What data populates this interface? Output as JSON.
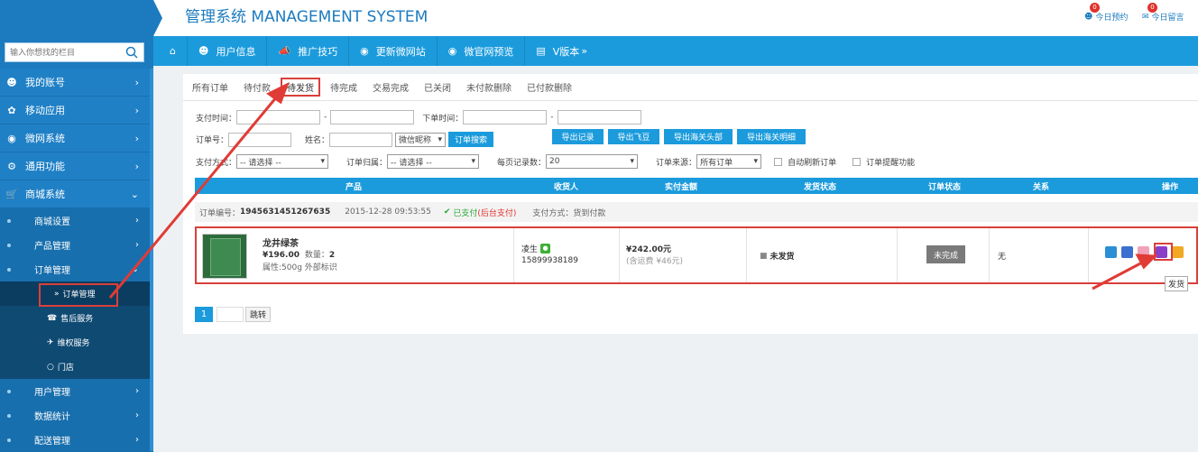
{
  "header": {
    "title": "管理系统 MANAGEMENT SYSTEM",
    "links": [
      {
        "label": "今日预约",
        "badge": "0",
        "icon": "user-icon"
      },
      {
        "label": "今日留言",
        "badge": "0",
        "icon": "message-icon"
      }
    ]
  },
  "sidebar": {
    "search_placeholder": "输入你想找的栏目",
    "items": [
      {
        "label": "我的账号",
        "icon": "user-icon"
      },
      {
        "label": "移动应用",
        "icon": "apps-icon"
      },
      {
        "label": "微网系统",
        "icon": "globe-icon"
      },
      {
        "label": "通用功能",
        "icon": "tool-icon"
      },
      {
        "label": "商城系统",
        "icon": "cart-icon"
      }
    ],
    "subitems": [
      "商城设置",
      "产品管理",
      "订单管理"
    ],
    "subsub": [
      "订单管理",
      "售后服务",
      "维权服务",
      "门店"
    ],
    "more": [
      "用户管理",
      "数据统计",
      "配送管理"
    ]
  },
  "topnav": [
    {
      "label": "",
      "icon": "home-icon"
    },
    {
      "label": "用户信息",
      "icon": "user-icon"
    },
    {
      "label": "推广技巧",
      "icon": "megaphone-icon"
    },
    {
      "label": "更新微网站",
      "icon": "globe-icon"
    },
    {
      "label": "微官网预览",
      "icon": "eye-icon"
    },
    {
      "label": "V版本",
      "icon": "file-icon"
    }
  ],
  "tabs": [
    "所有订单",
    "待付款",
    "待发货",
    "待完成",
    "交易完成",
    "已关闭",
    "未付款删除",
    "已付款删除"
  ],
  "filters": {
    "pay_time": "支付时间：",
    "order_time": "下单时间：",
    "dash": "-",
    "order_no": "订单号：",
    "name": "姓名：",
    "wechat_select": "微信昵称",
    "search_btn": "订单搜索",
    "export_buttons": [
      "导出记录",
      "导出飞豆",
      "导出海关头部",
      "导出海关明细"
    ],
    "pay_method": "支付方式：",
    "pay_method_value": "-- 请选择 --",
    "order_belong": "订单归属：",
    "order_belong_value": "-- 请选择 --",
    "per_page": "每页记录数：",
    "per_page_value": "20",
    "order_source": "订单来源：",
    "order_source_value": "所有订单",
    "auto_refresh": "自动刷新订单",
    "remind": "订单提醒功能"
  },
  "table": {
    "headers": [
      "产品",
      "收货人",
      "实付金额",
      "发货状态",
      "订单状态",
      "关系",
      "操作"
    ]
  },
  "order": {
    "number_label": "订单编号：",
    "number": "1945631451267635",
    "time": "2015-12-28 09:53:55",
    "paid": "已支付",
    "paid_note": "(后台支付)",
    "pay_method": "支付方式：货到付款",
    "product_name": "龙井绿茶",
    "price": "¥196.00",
    "qty_label": "数量：",
    "qty": "2",
    "attrs": "属性:500g 外部标识",
    "receiver": "凌生",
    "phone": "15899938189",
    "amount": "¥242.00元",
    "shipping_note": "(含运费 ¥46元)",
    "ship_status": "未发货",
    "order_status": "未完成",
    "relation": "无"
  },
  "pager": {
    "page": "1",
    "jump": "跳转"
  },
  "tooltip": "发货",
  "colors": {
    "primary": "#1b9bdc",
    "sidebar": "#1c7bbf",
    "highlight": "#d9403b"
  }
}
